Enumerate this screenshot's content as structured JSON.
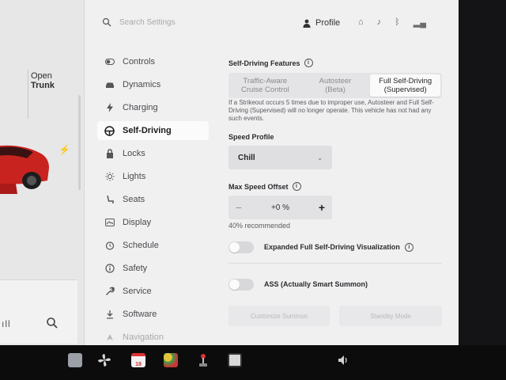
{
  "left": {
    "trunk_open": "Open",
    "trunk_label": "Trunk"
  },
  "topbar": {
    "search_placeholder": "Search Settings",
    "profile_label": "Profile"
  },
  "sidebar": {
    "items": [
      {
        "label": "Controls",
        "icon": "toggle-icon"
      },
      {
        "label": "Dynamics",
        "icon": "car-icon"
      },
      {
        "label": "Charging",
        "icon": "bolt-icon"
      },
      {
        "label": "Self-Driving",
        "icon": "steering-wheel-icon"
      },
      {
        "label": "Locks",
        "icon": "lock-icon"
      },
      {
        "label": "Lights",
        "icon": "sun-icon"
      },
      {
        "label": "Seats",
        "icon": "seat-icon"
      },
      {
        "label": "Display",
        "icon": "display-icon"
      },
      {
        "label": "Schedule",
        "icon": "alarm-icon"
      },
      {
        "label": "Safety",
        "icon": "info-circle-icon"
      },
      {
        "label": "Service",
        "icon": "wrench-icon"
      },
      {
        "label": "Software",
        "icon": "download-icon"
      },
      {
        "label": "Navigation",
        "icon": "nav-icon"
      }
    ],
    "active": "Self-Driving"
  },
  "content": {
    "features_title": "Self-Driving Features",
    "segments": [
      {
        "line1": "Traffic-Aware",
        "line2": "Cruise Control"
      },
      {
        "line1": "Autosteer",
        "line2": "(Beta)"
      },
      {
        "line1": "Full Self-Driving",
        "line2": "(Supervised)"
      }
    ],
    "selected_segment": "Full Self-Driving (Supervised)",
    "notice": "If a Strikeout occurs 5 times due to improper use, Autosteer and Full Self-Driving (Supervised) will no longer operate. This vehicle has not had any such events.",
    "speed_profile_title": "Speed Profile",
    "speed_profile_value": "Chill",
    "offset_title": "Max Speed Offset",
    "offset_value": "+0 %",
    "offset_minus": "−",
    "offset_plus": "+",
    "recommended": "40% recommended",
    "toggle1_label": "Expanded Full Self-Driving Visualization",
    "toggle2_label": "ASS (Actually Smart Summon)",
    "button_summon": "Customize Summon",
    "button_standby": "Standby Mode"
  },
  "taskbar": {
    "calendar_day": "18"
  },
  "colors": {
    "accent_red": "#c8231f",
    "panel_bg": "#f0f0f1",
    "active_item_bg": "#fbfbfc"
  }
}
